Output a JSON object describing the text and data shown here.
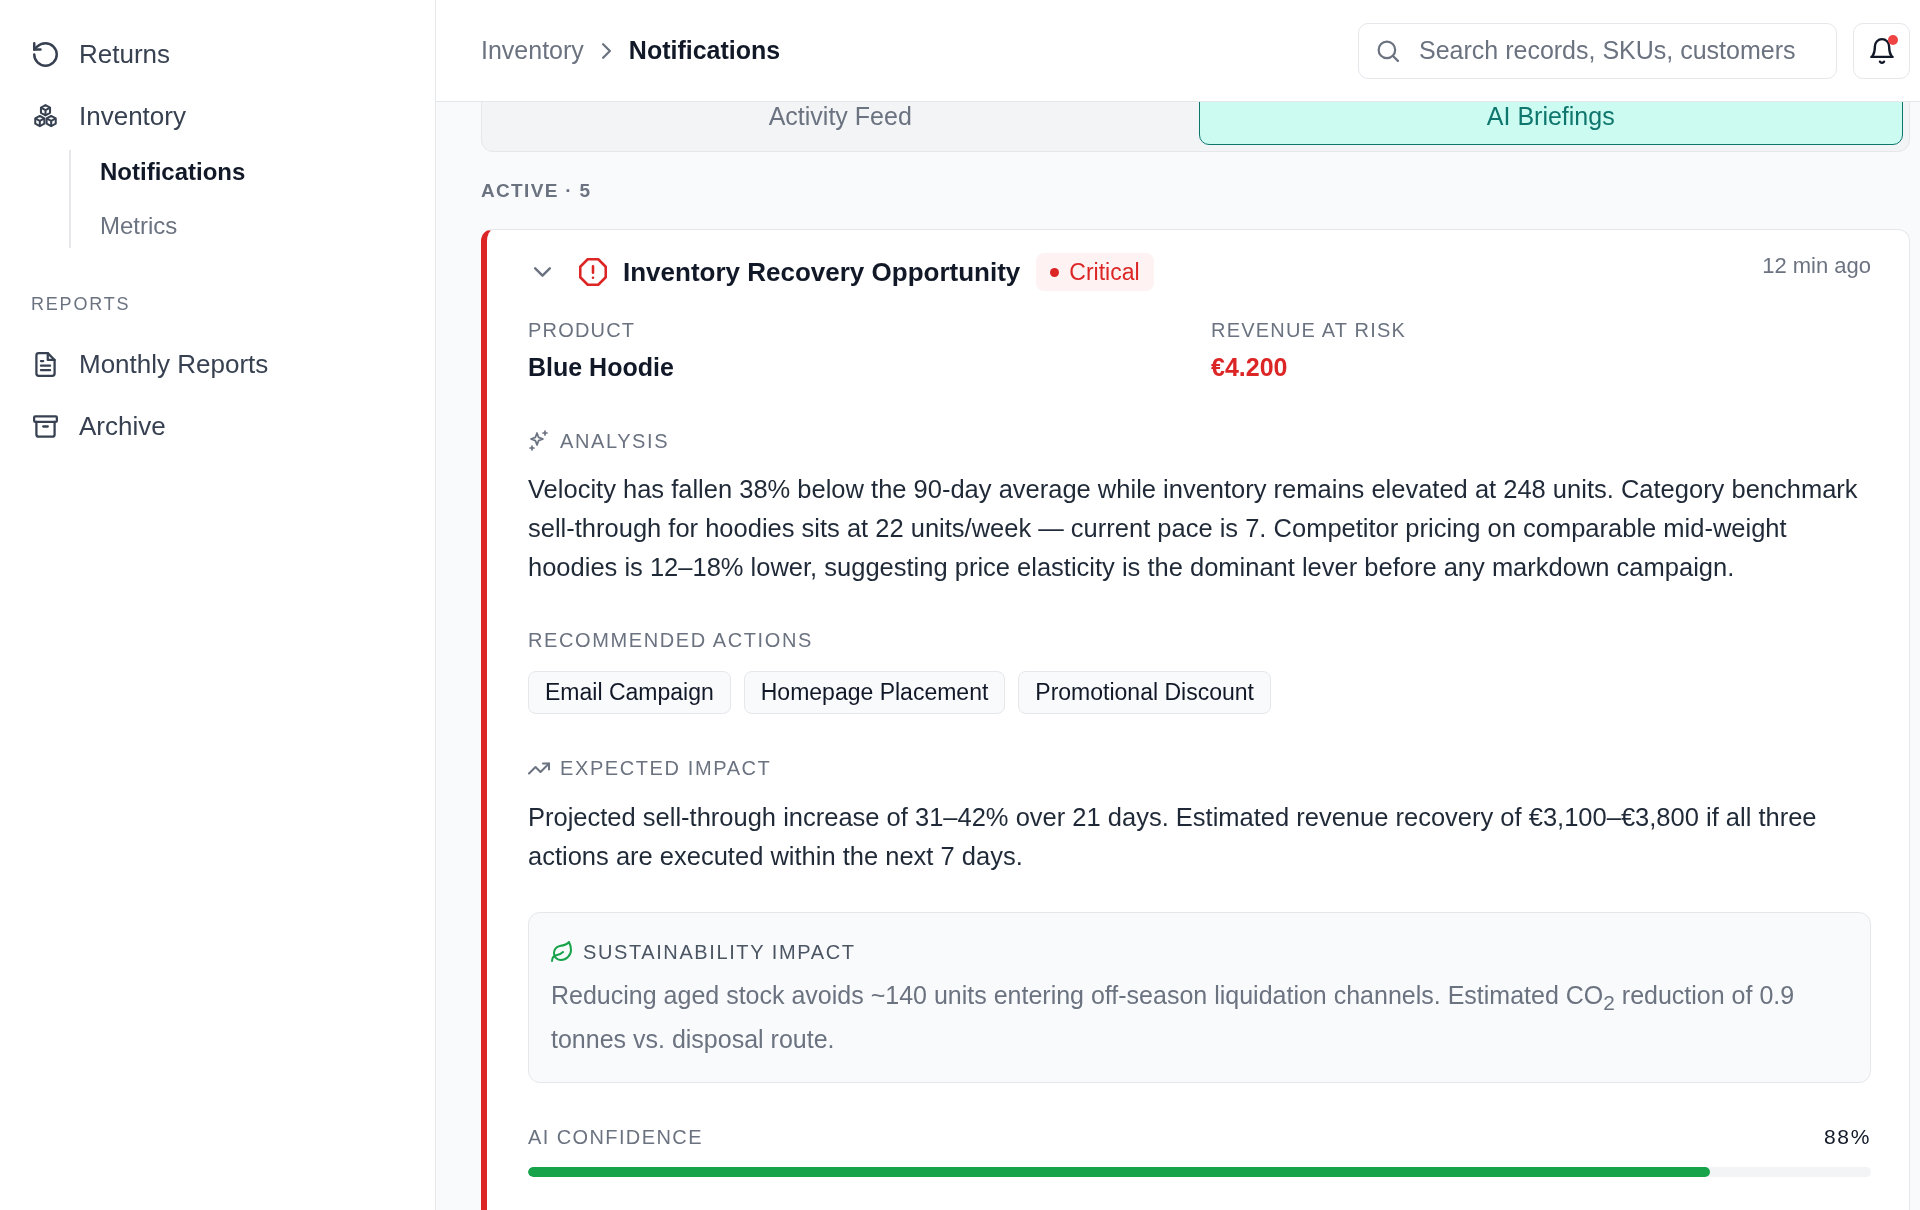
{
  "sidebar": {
    "sections": [
      {
        "items": [
          {
            "label": "Returns",
            "selected": false
          },
          {
            "label": "Inventory",
            "selected": false,
            "children": [
              {
                "label": "Notifications",
                "selected": true
              },
              {
                "label": "Metrics",
                "selected": false
              }
            ]
          }
        ]
      },
      {
        "title": "REPORTS",
        "items": [
          {
            "label": "Monthly Reports",
            "selected": false
          },
          {
            "label": "Archive",
            "selected": false
          }
        ]
      }
    ]
  },
  "header": {
    "breadcrumb": [
      "Inventory",
      "Notifications"
    ],
    "search": {
      "placeholder": "Search records, SKUs, customers"
    },
    "notifications": {
      "unread": true
    }
  },
  "tabs": [
    {
      "label": "Activity Feed",
      "selected": false
    },
    {
      "label": "AI Briefings",
      "selected": true
    }
  ],
  "list_heading": "ACTIVE · 5",
  "briefing": {
    "expanded": true,
    "title": "Inventory Recovery Opportunity",
    "badge": {
      "label": "Critical",
      "kind": "critical"
    },
    "time": "12 min ago",
    "fields": [
      {
        "label": "PRODUCT",
        "value": "Blue Hoodie",
        "kind": "plain"
      },
      {
        "label": "REVENUE AT RISK",
        "value": "€4.200",
        "kind": "alert"
      }
    ],
    "analysis": {
      "heading": "ANALYSIS",
      "text": "Velocity has fallen 38% below the 90-day average while inventory remains elevated at 248 units. Category benchmark sell-through for hoodies sits at 22 units/week — current pace is 7. Competitor pricing on comparable mid-weight hoodies is 12–18% lower, suggesting price elasticity is the dominant lever before any markdown campaign."
    },
    "actions": {
      "heading": "RECOMMENDED ACTIONS",
      "items": [
        "Email Campaign",
        "Homepage Placement",
        "Promotional Discount"
      ]
    },
    "impact": {
      "heading": "EXPECTED IMPACT",
      "text": "Projected sell-through increase of 31–42% over 21 days. Estimated revenue recovery of €3,100–€3,800 if all three actions are executed within the next 7 days."
    },
    "sustainability": {
      "heading": "SUSTAINABILITY IMPACT",
      "text": "Reducing aged stock avoids ~140 units entering off-season liquidation channels. Estimated CO$_{2}$ reduction of 0.9 tonnes vs. disposal route."
    },
    "confidence": {
      "label": "AI CONFIDENCE",
      "reading": "88%",
      "level": 0.88
    }
  }
}
